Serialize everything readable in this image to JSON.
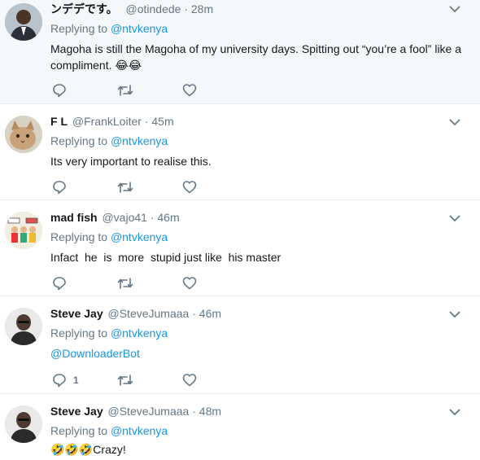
{
  "tweets": [
    {
      "name": "ンデデです。",
      "handle": "@otindede",
      "sep": "·",
      "time": "28m",
      "replying_prefix": "Replying to",
      "replying_to": "@ntvkenya",
      "text": "Magoha is still the Magoha of my university days. Spitting out “you’re a fool” like a compliment. 😂😂",
      "reply_count": "",
      "avatar_icon": "man-in-suit-avatar"
    },
    {
      "name": "F L",
      "handle": "@FrankLoiter",
      "sep": "·",
      "time": "45m",
      "replying_prefix": "Replying to",
      "replying_to": "@ntvkenya",
      "text": "Its very important to realise this.",
      "reply_count": "",
      "avatar_icon": "cat-avatar"
    },
    {
      "name": "mad fish",
      "handle": "@vajo41",
      "sep": "·",
      "time": "46m",
      "replying_prefix": "Replying to",
      "replying_to": "@ntvkenya",
      "text": "Infact  he  is  more  stupid just like  his master",
      "reply_count": "",
      "avatar_icon": "cartoon-avatar"
    },
    {
      "name": "Steve Jay",
      "handle": "@SteveJumaaa",
      "sep": "·",
      "time": "46m",
      "replying_prefix": "Replying to",
      "replying_to": "@ntvkenya",
      "text": "@DownloaderBot",
      "reply_count": "1",
      "avatar_icon": "bald-man-avatar"
    },
    {
      "name": "Steve Jay",
      "handle": "@SteveJumaaa",
      "sep": "·",
      "time": "48m",
      "replying_prefix": "Replying to",
      "replying_to": "@ntvkenya",
      "text": "🤣🤣🤣Crazy!",
      "reply_count": "",
      "avatar_icon": "bald-man-avatar"
    }
  ],
  "colors": {
    "link": "#1b95e0",
    "muted": "#657786",
    "highlight_bg": "#f5f8fa",
    "divider": "#e6ecf0"
  }
}
